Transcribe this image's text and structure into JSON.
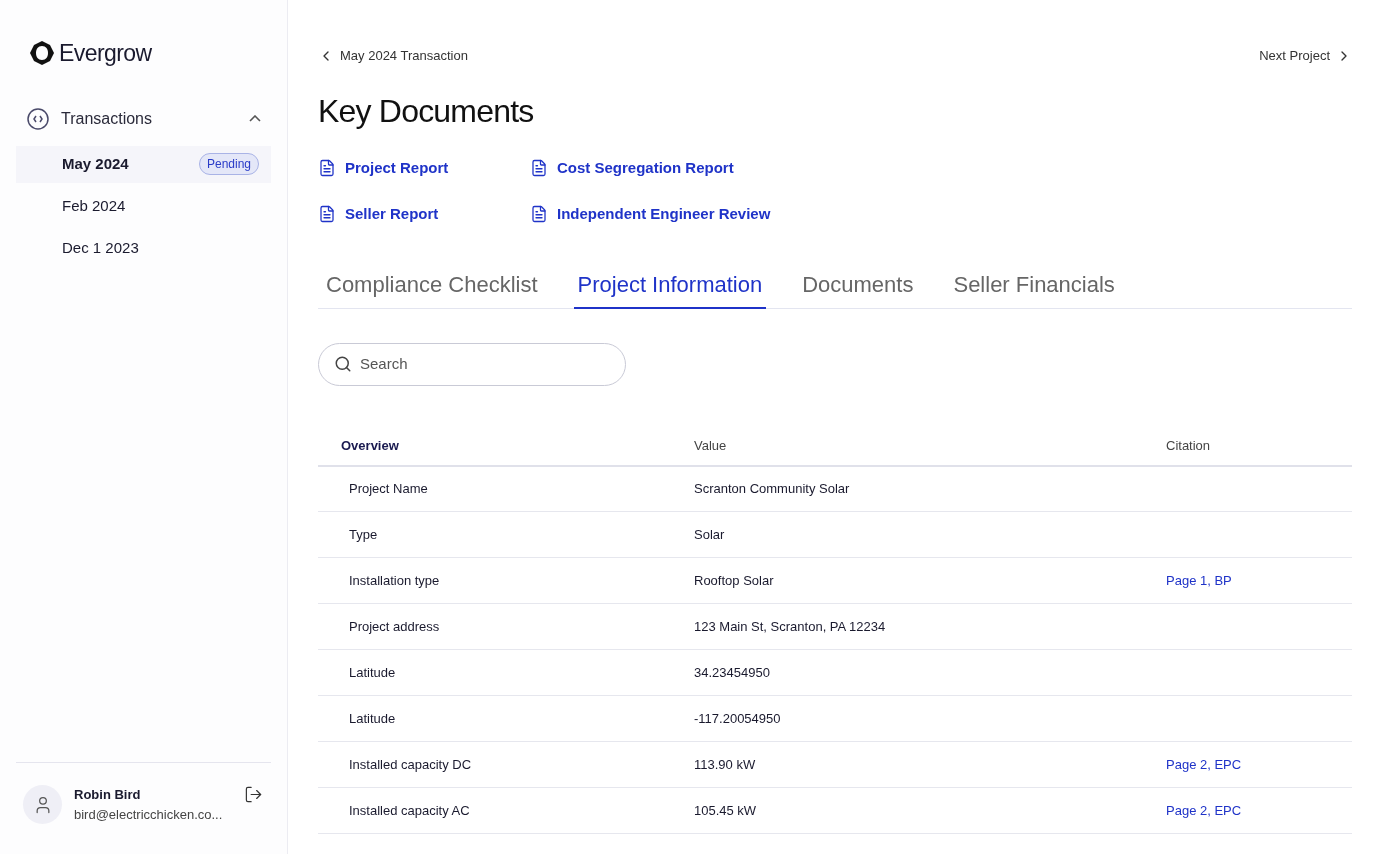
{
  "sidebar": {
    "brand": "Evergrow",
    "section": {
      "label": "Transactions",
      "expanded": true,
      "items": [
        {
          "label": "May 2024",
          "selected": true,
          "badge": "Pending"
        },
        {
          "label": "Feb 2024",
          "selected": false
        },
        {
          "label": "Dec 1 2023",
          "selected": false
        }
      ]
    },
    "user": {
      "name": "Robin Bird",
      "email": "bird@electricchicken.co..."
    }
  },
  "nav": {
    "back": "May 2024 Transaction",
    "next": "Next Project"
  },
  "title": "Key Documents",
  "documents": [
    "Project Report",
    "Cost Segregation Report",
    "Seller Report",
    "Independent Engineer Review"
  ],
  "tabs": [
    {
      "label": "Compliance Checklist",
      "selected": false
    },
    {
      "label": "Project Information",
      "selected": true
    },
    {
      "label": "Documents",
      "selected": false
    },
    {
      "label": "Seller Financials",
      "selected": false
    }
  ],
  "search": {
    "placeholder": "Search"
  },
  "table": {
    "columns": [
      "Overview",
      "Value",
      "Citation"
    ],
    "rows": [
      {
        "label": "Project Name",
        "value": "Scranton Community Solar"
      },
      {
        "label": "Type",
        "value": "Solar"
      },
      {
        "label": "Installation type",
        "value": "Rooftop Solar",
        "citation": "Page 1, BP"
      },
      {
        "label": "Project address",
        "value": "123 Main St, Scranton, PA 12234"
      },
      {
        "label": "Latitude",
        "value": "34.23454950"
      },
      {
        "label": "Latitude",
        "value": "-117.20054950"
      },
      {
        "label": "Installed capacity DC",
        "value": "113.90 kW",
        "citation": "Page 2, EPC"
      },
      {
        "label": "Installed capacity AC",
        "value": "105.45 kW",
        "citation": "Page 2, EPC"
      }
    ]
  }
}
